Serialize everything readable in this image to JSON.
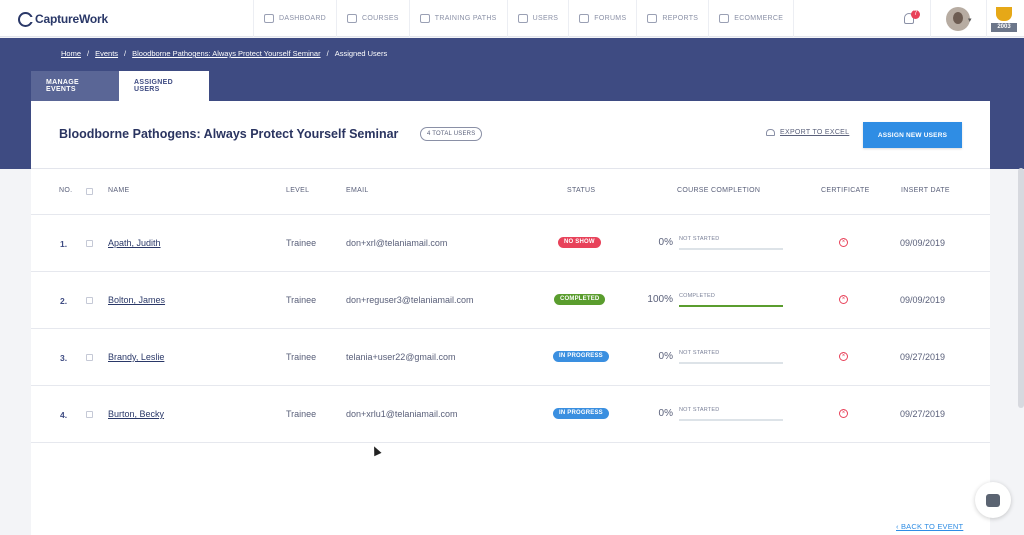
{
  "brand": {
    "name": "CaptureWork"
  },
  "nav": [
    {
      "label": "DASHBOARD",
      "icon": "dashboard-icon"
    },
    {
      "label": "COURSES",
      "icon": "courses-icon"
    },
    {
      "label": "TRAINING PATHS",
      "icon": "training-paths-icon"
    },
    {
      "label": "USERS",
      "icon": "users-icon"
    },
    {
      "label": "FORUMS",
      "icon": "forums-icon"
    },
    {
      "label": "REPORTS",
      "icon": "reports-icon"
    },
    {
      "label": "ECOMMERCE",
      "icon": "ecommerce-icon"
    }
  ],
  "notifications": {
    "count": "7"
  },
  "badge": {
    "year": "2003"
  },
  "breadcrumb": {
    "home": "Home",
    "events": "Events",
    "event": "Bloodborne Pathogens: Always Protect Yourself Seminar",
    "current": "Assigned Users",
    "sep": "/"
  },
  "tabs": {
    "manage": "MANAGE EVENTS",
    "assigned": "ASSIGNED USERS"
  },
  "header": {
    "title": "Bloodborne Pathogens: Always Protect Yourself Seminar",
    "total": "4 TOTAL USERS",
    "export": "EXPORT TO EXCEL",
    "assign": "ASSIGN NEW USERS"
  },
  "columns": {
    "no": "NO.",
    "name": "NAME",
    "level": "LEVEL",
    "email": "EMAIL",
    "status": "STATUS",
    "completion": "COURSE COMPLETION",
    "certificate": "CERTIFICATE",
    "date": "INSERT DATE"
  },
  "rows": [
    {
      "no": "1.",
      "name": "Apath, Judith",
      "level": "Trainee",
      "email": "don+xrl@telaniamail.com",
      "status": "NO SHOW",
      "status_color": "#e8425a",
      "pct": "0%",
      "progress": 0,
      "completion": "NOT STARTED",
      "date": "09/09/2019"
    },
    {
      "no": "2.",
      "name": "Bolton, James",
      "level": "Trainee",
      "email": "don+reguser3@telaniamail.com",
      "status": "COMPLETED",
      "status_color": "#5a9d2e",
      "pct": "100%",
      "progress": 100,
      "completion": "COMPLETED",
      "date": "09/09/2019"
    },
    {
      "no": "3.",
      "name": "Brandy, Leslie",
      "level": "Trainee",
      "email": "telania+user22@gmail.com",
      "status": "IN PROGRESS",
      "status_color": "#3a8fe0",
      "pct": "0%",
      "progress": 0,
      "completion": "NOT STARTED",
      "date": "09/27/2019"
    },
    {
      "no": "4.",
      "name": "Burton, Becky",
      "level": "Trainee",
      "email": "don+xrlu1@telaniamail.com",
      "status": "IN PROGRESS",
      "status_color": "#3a8fe0",
      "pct": "0%",
      "progress": 0,
      "completion": "NOT STARTED",
      "date": "09/27/2019"
    }
  ],
  "footer": {
    "back": "BACK TO EVENT"
  },
  "colors": {
    "banner": "#3e4b82",
    "accent": "#2f8de4"
  }
}
